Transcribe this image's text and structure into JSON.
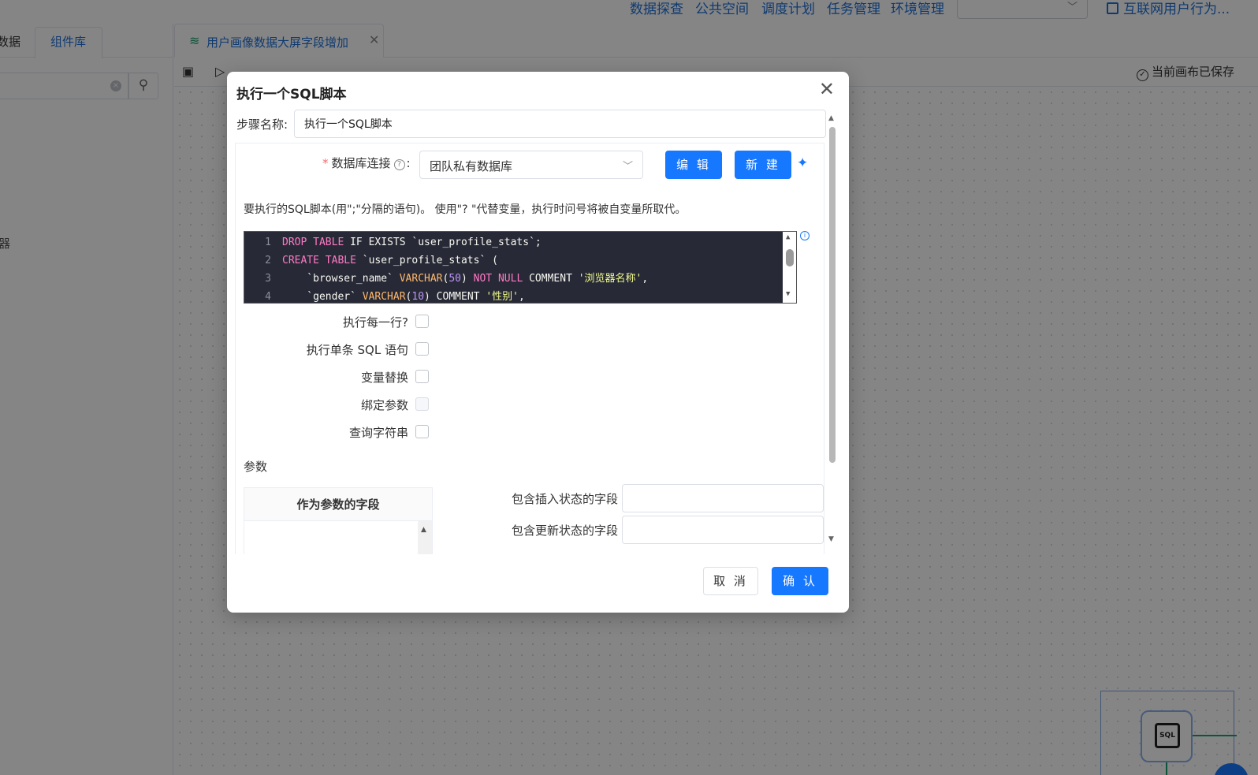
{
  "topnav": {
    "items": [
      "数据探查",
      "公共空间",
      "调度计划",
      "任务管理",
      "环境管理"
    ],
    "workspace_select_value": "",
    "project_label": "互联网用户行为..."
  },
  "left_panel": {
    "tabs": [
      "数据",
      "组件库"
    ],
    "search_placeholder": "",
    "fragment_text": "器"
  },
  "document_tab": {
    "label": "用户画像数据大屏字段增加"
  },
  "toolbar": {
    "save_status": "当前画布已保存"
  },
  "dialog": {
    "title": "执行一个SQL脚本",
    "step_name_label": "步骤名称:",
    "step_name_value": "执行一个SQL脚本",
    "db_connection_label": "数据库连接",
    "db_connection_value": "团队私有数据库",
    "edit_button": "编 辑",
    "new_button": "新 建",
    "sql_hint": "要执行的SQL脚本(用\";\"分隔的语句)。 使用\"? \"代替变量，执行时问号将被自变量所取代。",
    "sql_lines": [
      {
        "no": "1",
        "tokens": [
          [
            "kw",
            "DROP TABLE"
          ],
          [
            "plain",
            " IF EXISTS `user_profile_stats`;"
          ]
        ]
      },
      {
        "no": "2",
        "tokens": [
          [
            "kw",
            "CREATE TABLE"
          ],
          [
            "plain",
            " `user_profile_stats` ("
          ]
        ]
      },
      {
        "no": "3",
        "tokens": [
          [
            "plain",
            "    `browser_name` "
          ],
          [
            "type",
            "VARCHAR"
          ],
          [
            "plain",
            "("
          ],
          [
            "num",
            "50"
          ],
          [
            "plain",
            ") "
          ],
          [
            "nn",
            "NOT NULL"
          ],
          [
            "plain",
            " COMMENT "
          ],
          [
            "str",
            "'浏览器名称'"
          ],
          [
            "plain",
            ","
          ]
        ]
      },
      {
        "no": "4",
        "tokens": [
          [
            "plain",
            "    `gender` "
          ],
          [
            "type",
            "VARCHAR"
          ],
          [
            "plain",
            "("
          ],
          [
            "num",
            "10"
          ],
          [
            "plain",
            ") COMMENT "
          ],
          [
            "str",
            "'性别'"
          ],
          [
            "plain",
            ","
          ]
        ]
      }
    ],
    "options": [
      {
        "label": "执行每一行?",
        "checked": false,
        "disabled": false
      },
      {
        "label": "执行单条 SQL 语句",
        "checked": false,
        "disabled": false
      },
      {
        "label": "变量替换",
        "checked": false,
        "disabled": false
      },
      {
        "label": "绑定参数",
        "checked": false,
        "disabled": true
      },
      {
        "label": "查询字符串",
        "checked": false,
        "disabled": false
      }
    ],
    "params_title": "参数",
    "param_table_header": "作为参数的字段",
    "insert_status_field_label": "包含插入状态的字段",
    "insert_status_field_value": "",
    "update_status_field_label": "包含更新状态的字段",
    "update_status_field_value": "",
    "cancel_button": "取 消",
    "ok_button": "确 认"
  },
  "colors": {
    "primary": "#1677ff",
    "link": "#1e6fd9",
    "editor_bg": "#272a36",
    "required": "#f56c6c"
  }
}
